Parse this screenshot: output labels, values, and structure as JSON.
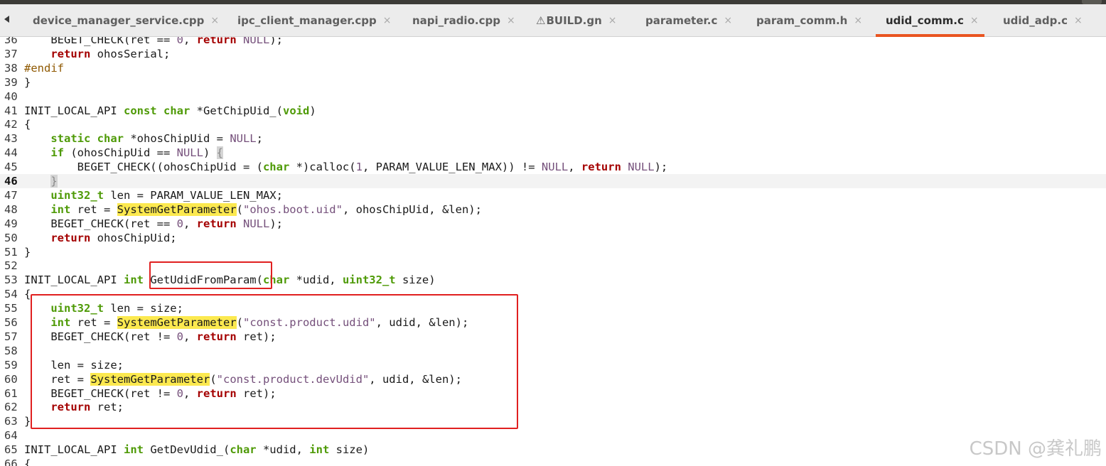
{
  "tabs": [
    {
      "label": "device_manager_service.cpp",
      "active": false,
      "warning": false
    },
    {
      "label": "ipc_client_manager.cpp",
      "active": false,
      "warning": false
    },
    {
      "label": "napi_radio.cpp",
      "active": false,
      "warning": false
    },
    {
      "label": "BUILD.gn",
      "active": false,
      "warning": true
    },
    {
      "label": "parameter.c",
      "active": false,
      "warning": false
    },
    {
      "label": "param_comm.h",
      "active": false,
      "warning": false
    },
    {
      "label": "udid_comm.c",
      "active": true,
      "warning": false
    },
    {
      "label": "udid_adp.c",
      "active": false,
      "warning": false
    }
  ],
  "close_glyph": "×",
  "warning_glyph": "⚠",
  "scroll_left_icon": "triangle-left-icon",
  "accent_color": "#e95420",
  "highlight_color": "#fce94f",
  "annotation_color": "#e02020",
  "current_line": "46",
  "editor": {
    "lines": [
      {
        "n": "36",
        "segs": [
          [
            "",
            "    BEGET_CHECK(ret == "
          ],
          [
            "num",
            "0"
          ],
          [
            "",
            ", "
          ],
          [
            "ret",
            "return"
          ],
          [
            "",
            " "
          ],
          [
            "nul",
            "NULL"
          ],
          [
            "",
            ");"
          ]
        ]
      },
      {
        "n": "37",
        "segs": [
          [
            "",
            "    "
          ],
          [
            "ret",
            "return"
          ],
          [
            "",
            " ohosSerial;"
          ]
        ]
      },
      {
        "n": "38",
        "segs": [
          [
            "pp",
            "#endif"
          ]
        ]
      },
      {
        "n": "39",
        "segs": [
          [
            "",
            "}"
          ]
        ]
      },
      {
        "n": "40",
        "segs": []
      },
      {
        "n": "41",
        "segs": [
          [
            "",
            "INIT_LOCAL_API "
          ],
          [
            "kw",
            "const"
          ],
          [
            "",
            " "
          ],
          [
            "kw",
            "char"
          ],
          [
            "",
            " *GetChipUid_("
          ],
          [
            "kw",
            "void"
          ],
          [
            "",
            ")"
          ]
        ]
      },
      {
        "n": "42",
        "segs": [
          [
            "",
            "{"
          ]
        ]
      },
      {
        "n": "43",
        "segs": [
          [
            "",
            "    "
          ],
          [
            "kw",
            "static"
          ],
          [
            "",
            " "
          ],
          [
            "kw",
            "char"
          ],
          [
            "",
            " *ohosChipUid = "
          ],
          [
            "nul",
            "NULL"
          ],
          [
            "",
            ";"
          ]
        ]
      },
      {
        "n": "44",
        "segs": [
          [
            "",
            "    "
          ],
          [
            "kw",
            "if"
          ],
          [
            "",
            " (ohosChipUid == "
          ],
          [
            "nul",
            "NULL"
          ],
          [
            "",
            ") "
          ],
          [
            "brace-hl",
            "{"
          ]
        ]
      },
      {
        "n": "45",
        "segs": [
          [
            "",
            "        BEGET_CHECK((ohosChipUid = ("
          ],
          [
            "kw",
            "char"
          ],
          [
            "",
            " *)calloc("
          ],
          [
            "num",
            "1"
          ],
          [
            "",
            ", PARAM_VALUE_LEN_MAX)) != "
          ],
          [
            "nul",
            "NULL"
          ],
          [
            "",
            ", "
          ],
          [
            "ret",
            "return"
          ],
          [
            "",
            " "
          ],
          [
            "nul",
            "NULL"
          ],
          [
            "",
            ");"
          ]
        ]
      },
      {
        "n": "46",
        "segs": [
          [
            "",
            "    "
          ],
          [
            "brace-hl",
            "}"
          ]
        ]
      },
      {
        "n": "47",
        "segs": [
          [
            "",
            "    "
          ],
          [
            "kw",
            "uint32_t"
          ],
          [
            "",
            " len = PARAM_VALUE_LEN_MAX;"
          ]
        ]
      },
      {
        "n": "48",
        "segs": [
          [
            "",
            "    "
          ],
          [
            "kw",
            "int"
          ],
          [
            "",
            " ret = "
          ],
          [
            "hl",
            "SystemGetParameter"
          ],
          [
            "",
            "("
          ],
          [
            "str",
            "\"ohos.boot.uid\""
          ],
          [
            "",
            ", ohosChipUid, &len);"
          ]
        ]
      },
      {
        "n": "49",
        "segs": [
          [
            "",
            "    BEGET_CHECK(ret == "
          ],
          [
            "num",
            "0"
          ],
          [
            "",
            ", "
          ],
          [
            "ret",
            "return"
          ],
          [
            "",
            " "
          ],
          [
            "nul",
            "NULL"
          ],
          [
            "",
            ");"
          ]
        ]
      },
      {
        "n": "50",
        "segs": [
          [
            "",
            "    "
          ],
          [
            "ret",
            "return"
          ],
          [
            "",
            " ohosChipUid;"
          ]
        ]
      },
      {
        "n": "51",
        "segs": [
          [
            "",
            "}"
          ]
        ]
      },
      {
        "n": "52",
        "segs": []
      },
      {
        "n": "53",
        "segs": [
          [
            "",
            "INIT_LOCAL_API "
          ],
          [
            "kw",
            "int"
          ],
          [
            "",
            " GetUdidFromParam("
          ],
          [
            "kw",
            "char"
          ],
          [
            "",
            " *udid, "
          ],
          [
            "kw",
            "uint32_t"
          ],
          [
            "",
            " size)"
          ]
        ]
      },
      {
        "n": "54",
        "segs": [
          [
            "",
            "{"
          ]
        ]
      },
      {
        "n": "55",
        "segs": [
          [
            "",
            "    "
          ],
          [
            "kw",
            "uint32_t"
          ],
          [
            "",
            " len = size;"
          ]
        ]
      },
      {
        "n": "56",
        "segs": [
          [
            "",
            "    "
          ],
          [
            "kw",
            "int"
          ],
          [
            "",
            " ret = "
          ],
          [
            "hl",
            "SystemGetParameter"
          ],
          [
            "",
            "("
          ],
          [
            "str",
            "\"const.product.udid\""
          ],
          [
            "",
            ", udid, &len);"
          ]
        ]
      },
      {
        "n": "57",
        "segs": [
          [
            "",
            "    BEGET_CHECK(ret != "
          ],
          [
            "num",
            "0"
          ],
          [
            "",
            ", "
          ],
          [
            "ret",
            "return"
          ],
          [
            "",
            " ret);"
          ]
        ]
      },
      {
        "n": "58",
        "segs": []
      },
      {
        "n": "59",
        "segs": [
          [
            "",
            "    len = size;"
          ]
        ]
      },
      {
        "n": "60",
        "segs": [
          [
            "",
            "    ret = "
          ],
          [
            "hl",
            "SystemGetParameter"
          ],
          [
            "",
            "("
          ],
          [
            "str",
            "\"const.product.devUdid\""
          ],
          [
            "",
            ", udid, &len);"
          ]
        ]
      },
      {
        "n": "61",
        "segs": [
          [
            "",
            "    BEGET_CHECK(ret != "
          ],
          [
            "num",
            "0"
          ],
          [
            "",
            ", "
          ],
          [
            "ret",
            "return"
          ],
          [
            "",
            " ret);"
          ]
        ]
      },
      {
        "n": "62",
        "segs": [
          [
            "",
            "    "
          ],
          [
            "ret",
            "return"
          ],
          [
            "",
            " ret;"
          ]
        ]
      },
      {
        "n": "63",
        "segs": [
          [
            "",
            "}"
          ]
        ]
      },
      {
        "n": "64",
        "segs": []
      },
      {
        "n": "65",
        "segs": [
          [
            "",
            "INIT_LOCAL_API "
          ],
          [
            "kw",
            "int"
          ],
          [
            "",
            " GetDevUdid_("
          ],
          [
            "kw",
            "char"
          ],
          [
            "",
            " *udid, "
          ],
          [
            "kw",
            "int"
          ],
          [
            "",
            " size)"
          ]
        ]
      },
      {
        "n": "66",
        "segs": [
          [
            "",
            "{"
          ]
        ]
      }
    ]
  },
  "watermark": "CSDN @龚礼鹏"
}
